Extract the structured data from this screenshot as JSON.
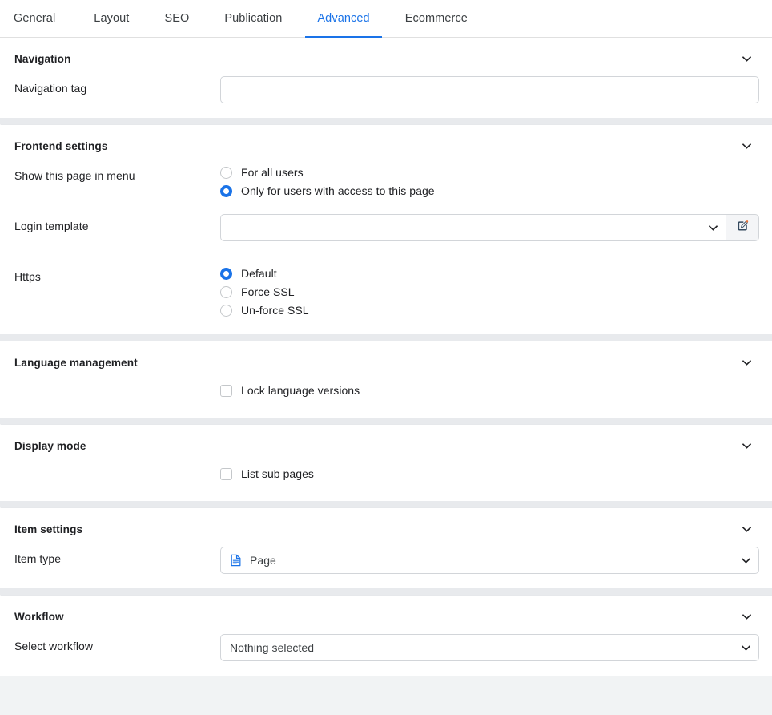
{
  "tabs": [
    {
      "label": "General",
      "active": false
    },
    {
      "label": "Layout",
      "active": false
    },
    {
      "label": "SEO",
      "active": false
    },
    {
      "label": "Publication",
      "active": false
    },
    {
      "label": "Advanced",
      "active": true
    },
    {
      "label": "Ecommerce",
      "active": false
    }
  ],
  "colors": {
    "accent": "#1a73e8",
    "text": "#202124",
    "border": "#d2d5d9",
    "section_gap": "#e8eaed"
  },
  "sections": {
    "navigation": {
      "title": "Navigation",
      "collapse_icon": "chevron-down-icon",
      "navigation_tag": {
        "label": "Navigation tag",
        "value": "",
        "placeholder": ""
      }
    },
    "frontend": {
      "title": "Frontend settings",
      "collapse_icon": "chevron-down-icon",
      "show_in_menu": {
        "label": "Show this page in menu",
        "options": [
          {
            "label": "For all users",
            "selected": false
          },
          {
            "label": "Only for users with access to this page",
            "selected": true
          }
        ]
      },
      "login_template": {
        "label": "Login template",
        "value": "",
        "edit_icon": "edit-pencil-square-icon",
        "dropdown_icon": "chevron-down-icon"
      },
      "https": {
        "label": "Https",
        "options": [
          {
            "label": "Default",
            "selected": true
          },
          {
            "label": "Force SSL",
            "selected": false
          },
          {
            "label": "Un-force SSL",
            "selected": false
          }
        ]
      }
    },
    "language": {
      "title": "Language management",
      "collapse_icon": "chevron-down-icon",
      "lock_versions": {
        "label": "Lock language versions",
        "checked": false
      }
    },
    "display": {
      "title": "Display mode",
      "collapse_icon": "chevron-down-icon",
      "list_sub_pages": {
        "label": "List sub pages",
        "checked": false
      }
    },
    "item": {
      "title": "Item settings",
      "collapse_icon": "chevron-down-icon",
      "item_type": {
        "label": "Item type",
        "value": "Page",
        "value_icon": "page-document-icon",
        "dropdown_icon": "chevron-down-icon"
      }
    },
    "workflow": {
      "title": "Workflow",
      "collapse_icon": "chevron-down-icon",
      "select_workflow": {
        "label": "Select workflow",
        "value": "Nothing selected",
        "dropdown_icon": "chevron-down-icon"
      }
    }
  }
}
